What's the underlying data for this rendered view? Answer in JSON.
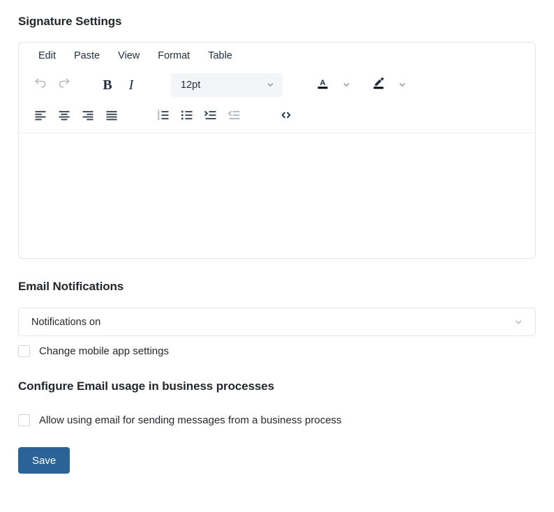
{
  "signature": {
    "heading": "Signature Settings",
    "editor": {
      "menus": [
        {
          "name": "edit",
          "label": "Edit"
        },
        {
          "name": "paste",
          "label": "Paste"
        },
        {
          "name": "view",
          "label": "View"
        },
        {
          "name": "format",
          "label": "Format"
        },
        {
          "name": "table",
          "label": "Table"
        }
      ],
      "toolbar_row1": {
        "undo": {
          "icon": "undo-icon",
          "title": "Undo",
          "disabled": true
        },
        "redo": {
          "icon": "redo-icon",
          "title": "Redo",
          "disabled": true
        },
        "bold": {
          "icon": "bold-icon",
          "label": "B",
          "title": "Bold"
        },
        "italic": {
          "icon": "italic-icon",
          "label": "I",
          "title": "Italic"
        },
        "font_size": {
          "value": "12pt",
          "title": "Font size"
        },
        "text_color": {
          "icon": "text-color-icon",
          "title": "Text color",
          "swatch": "#000000"
        },
        "background_color": {
          "icon": "background-color-icon",
          "title": "Background color",
          "swatch": "#000000"
        }
      },
      "toolbar_row2": {
        "align_left": {
          "icon": "align-left-icon",
          "title": "Align left"
        },
        "align_center": {
          "icon": "align-center-icon",
          "title": "Align center"
        },
        "align_right": {
          "icon": "align-right-icon",
          "title": "Align right"
        },
        "align_justify": {
          "icon": "align-justify-icon",
          "title": "Justify"
        },
        "numbered_list": {
          "icon": "numbered-list-icon",
          "title": "Numbered list"
        },
        "bullet_list": {
          "icon": "bullet-list-icon",
          "title": "Bullet list"
        },
        "indent": {
          "icon": "indent-icon",
          "title": "Increase indent"
        },
        "outdent": {
          "icon": "outdent-icon",
          "title": "Decrease indent",
          "disabled": true
        },
        "source_code": {
          "icon": "source-code-icon",
          "label": "<>",
          "title": "Source code"
        }
      },
      "content": ""
    }
  },
  "notifications": {
    "heading": "Email Notifications",
    "select": {
      "value": "Notifications on",
      "options": [
        "Notifications on"
      ]
    },
    "checkbox": {
      "label": "Change mobile app settings",
      "checked": false
    }
  },
  "business": {
    "heading": "Configure Email usage in business processes",
    "checkbox": {
      "label": "Allow using email for sending messages from a business process",
      "checked": false
    }
  },
  "actions": {
    "save_label": "Save"
  },
  "colors": {
    "accent": "#2a6496",
    "heading": "#23282d",
    "icon": "#222f3e",
    "icon_disabled": "#aeb3b8",
    "border": "#e4e4e4"
  }
}
